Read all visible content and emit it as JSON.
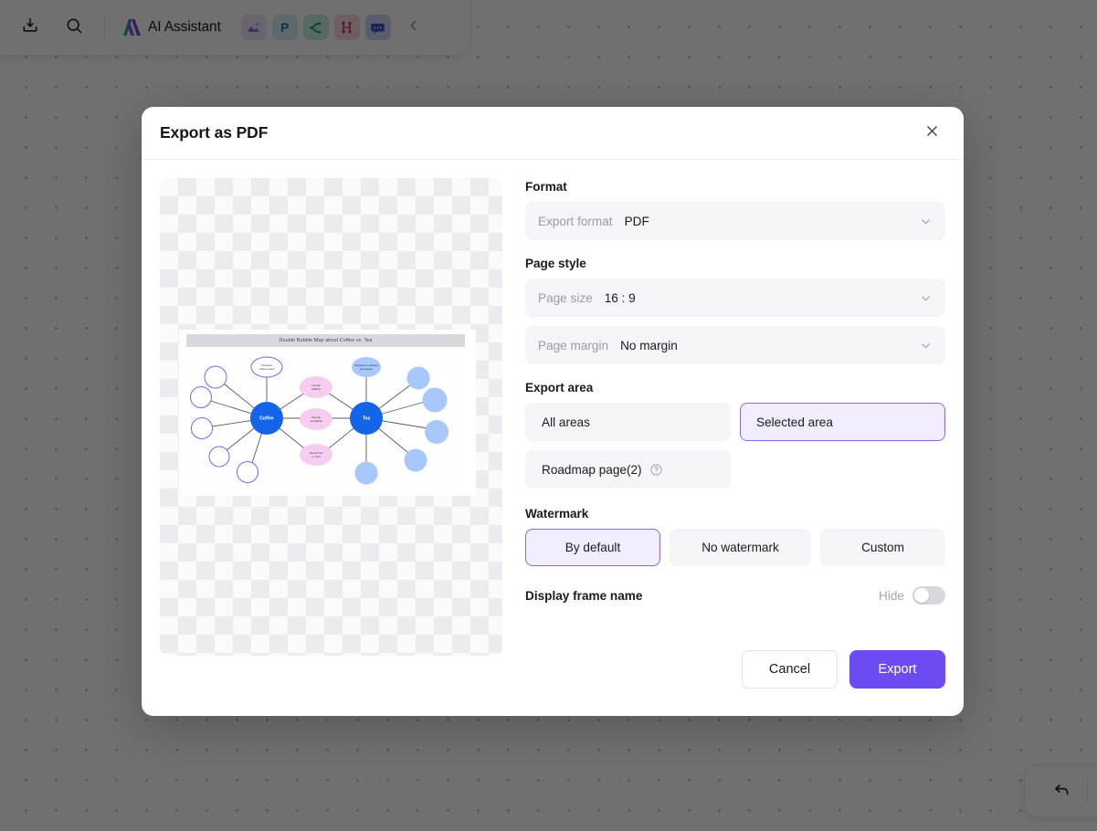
{
  "toolbar": {
    "import_icon": "download-icon",
    "search_icon": "search-icon",
    "ai_assistant_label": "AI Assistant",
    "apps": [
      {
        "name": "ai-image-icon",
        "glyph": "image"
      },
      {
        "name": "ppt-icon",
        "glyph": "P"
      },
      {
        "name": "mindmap-icon",
        "glyph": "mindmap"
      },
      {
        "name": "topic-tree-icon",
        "glyph": "tree"
      },
      {
        "name": "chat-icon",
        "glyph": "chat"
      }
    ],
    "collapse_icon": "chevron-left-icon"
  },
  "undo": {
    "icon": "undo-arrow-icon"
  },
  "dialog": {
    "title": "Export as PDF",
    "close_icon": "close-icon",
    "preview": {
      "sheet_title": "Double Bubble Map about Coffee vs. Tea"
    },
    "format": {
      "label": "Format",
      "export_format_key": "Export format",
      "export_format_value": "PDF",
      "chevron_icon": "chevron-down-icon"
    },
    "page_style": {
      "label": "Page style",
      "page_size_key": "Page size",
      "page_size_value": "16 : 9",
      "page_margin_key": "Page margin",
      "page_margin_value": "No margin",
      "chevron_icon": "chevron-down-icon"
    },
    "export_area": {
      "label": "Export area",
      "all_areas": "All areas",
      "selected_area": "Selected area",
      "roadmap_page": "Roadmap page(2)",
      "help_icon": "help-circle-icon",
      "selected": "Selected area"
    },
    "watermark": {
      "label": "Watermark",
      "by_default": "By default",
      "no_watermark": "No watermark",
      "custom": "Custom",
      "selected": "By default"
    },
    "display_frame_name": {
      "label": "Display frame name",
      "hide_label": "Hide",
      "enabled": false
    },
    "footer": {
      "cancel_label": "Cancel",
      "export_label": "Export"
    }
  },
  "colors": {
    "accent": "#6c4cf1",
    "accent_soft_bg": "#f1ecfe",
    "accent_border": "#8566f2",
    "field_bg": "#f5f5f7",
    "muted_text": "#9b9ba4"
  },
  "chart_data": {
    "type": "diagram",
    "title": "Double Bubble Map about Coffee vs. Tea",
    "centers": [
      {
        "label": "Coffee",
        "color": "#1464e8"
      },
      {
        "label": "Tea",
        "color": "#1464e8"
      }
    ],
    "shared_nodes": [
      {
        "label": "Contain caffeine",
        "color": "#f6cdf0"
      },
      {
        "label": "Popular worldwide",
        "color": "#f6cdf0"
      },
      {
        "label": "Served hot or cold",
        "color": "#f6cdf0"
      }
    ],
    "coffee_nodes": [
      {
        "label": "Roasted beans",
        "color": "#ffffff",
        "border": "#6b6bf0"
      },
      {
        "label": "",
        "color": "#ffffff",
        "border": "#6b6bf0"
      },
      {
        "label": "",
        "color": "#ffffff",
        "border": "#6b6bf0"
      },
      {
        "label": "",
        "color": "#ffffff",
        "border": "#6b6bf0"
      },
      {
        "label": "",
        "color": "#ffffff",
        "border": "#6b6bf0"
      },
      {
        "label": "",
        "color": "#ffffff",
        "border": "#6b6bf0"
      }
    ],
    "tea_nodes": [
      {
        "label": "Steeped leaves",
        "color": "#a8c8fb"
      },
      {
        "label": "",
        "color": "#a8c8fb"
      },
      {
        "label": "",
        "color": "#a8c8fb"
      },
      {
        "label": "",
        "color": "#a8c8fb"
      },
      {
        "label": "",
        "color": "#a8c8fb"
      },
      {
        "label": "",
        "color": "#a8c8fb"
      }
    ]
  }
}
